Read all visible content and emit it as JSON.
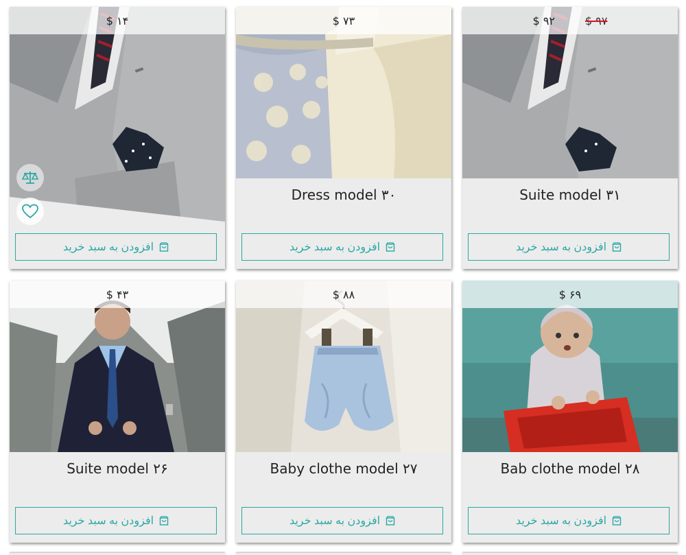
{
  "colors": {
    "accent": "#2aa7a4",
    "card_bg": "#ececec",
    "strike": "#dd1122"
  },
  "cart_label": "افزودن به سبد خرید",
  "products": [
    {
      "title": "",
      "price": "$ ۱۴",
      "old_price": "",
      "image": "gray-suit-pocket-square",
      "has_actions": true
    },
    {
      "title": "Dress model ۳۰",
      "price": "$ ۷۳",
      "old_price": "",
      "image": "lace-dress",
      "has_actions": false
    },
    {
      "title": "Suite model ۳۱",
      "price": "$ ۹۲",
      "old_price": "$ ۹۷",
      "image": "gray-suit-pocket-square",
      "has_actions": false
    },
    {
      "title": "Suite model ۲۶",
      "price": "$ ۴۳",
      "old_price": "",
      "image": "navy-suit-man",
      "has_actions": false
    },
    {
      "title": "Baby clothe model ۲۷",
      "price": "$ ۸۸",
      "old_price": "",
      "image": "baby-shorts-hanger",
      "has_actions": false
    },
    {
      "title": "Bab clothe model ۲۸",
      "price": "$ ۶۹",
      "old_price": "",
      "image": "baby-knit-outfit",
      "has_actions": false
    }
  ],
  "icons": {
    "compare": "scale-icon",
    "wishlist": "heart-icon",
    "cart": "shopping-bag-icon"
  }
}
